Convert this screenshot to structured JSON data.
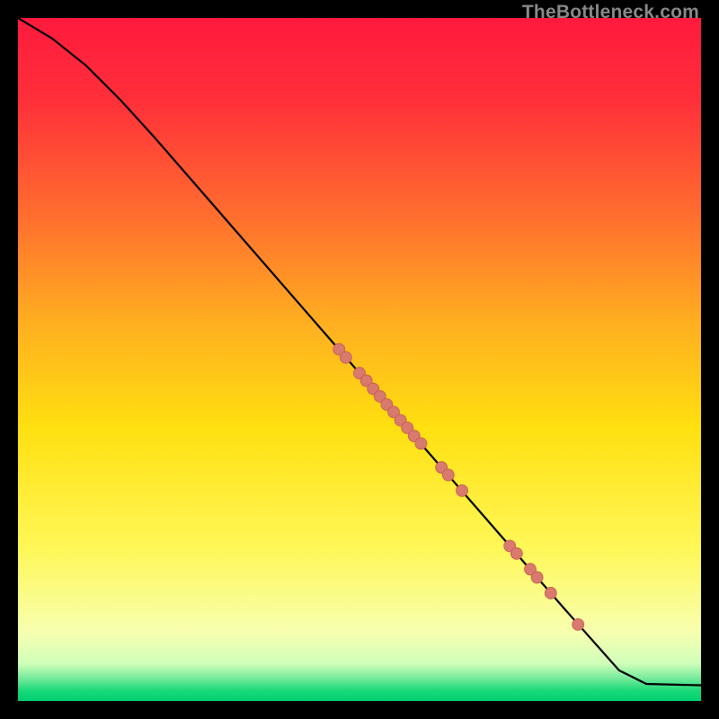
{
  "watermark": "TheBottleneck.com",
  "colors": {
    "background": "#000000",
    "gradient_stops": [
      {
        "offset": 0.0,
        "color": "#ff1a3d"
      },
      {
        "offset": 0.12,
        "color": "#ff2f3a"
      },
      {
        "offset": 0.28,
        "color": "#ff6a2f"
      },
      {
        "offset": 0.45,
        "color": "#ffb020"
      },
      {
        "offset": 0.6,
        "color": "#ffe010"
      },
      {
        "offset": 0.78,
        "color": "#fff85a"
      },
      {
        "offset": 0.9,
        "color": "#f7ffb0"
      },
      {
        "offset": 0.945,
        "color": "#d0ffba"
      },
      {
        "offset": 0.965,
        "color": "#7eec9e"
      },
      {
        "offset": 0.985,
        "color": "#18d978"
      },
      {
        "offset": 1.0,
        "color": "#00d072"
      }
    ],
    "curve": "#000000",
    "point_fill": "#d87a6e",
    "point_stroke": "#c65a4e"
  },
  "chart_data": {
    "type": "line",
    "title": "",
    "xlabel": "",
    "ylabel": "",
    "xlim": [
      0,
      100
    ],
    "ylim": [
      0,
      100
    ],
    "curve": [
      {
        "x": 0,
        "y": 100
      },
      {
        "x": 5,
        "y": 97
      },
      {
        "x": 10,
        "y": 93
      },
      {
        "x": 15,
        "y": 88
      },
      {
        "x": 20,
        "y": 82.5
      },
      {
        "x": 30,
        "y": 71
      },
      {
        "x": 40,
        "y": 59.5
      },
      {
        "x": 50,
        "y": 48
      },
      {
        "x": 60,
        "y": 36.5
      },
      {
        "x": 70,
        "y": 25
      },
      {
        "x": 80,
        "y": 13.5
      },
      {
        "x": 88,
        "y": 4.5
      },
      {
        "x": 92,
        "y": 2.5
      },
      {
        "x": 100,
        "y": 2.3
      }
    ],
    "points": [
      {
        "x": 47,
        "y": 51.5
      },
      {
        "x": 48,
        "y": 50.3
      },
      {
        "x": 50,
        "y": 48.0
      },
      {
        "x": 51,
        "y": 46.9
      },
      {
        "x": 52,
        "y": 45.7
      },
      {
        "x": 53,
        "y": 44.6
      },
      {
        "x": 54,
        "y": 43.4
      },
      {
        "x": 55,
        "y": 42.3
      },
      {
        "x": 56,
        "y": 41.1
      },
      {
        "x": 57,
        "y": 40.0
      },
      {
        "x": 58,
        "y": 38.8
      },
      {
        "x": 59,
        "y": 37.7
      },
      {
        "x": 62,
        "y": 34.2
      },
      {
        "x": 63,
        "y": 33.1
      },
      {
        "x": 65,
        "y": 30.8
      },
      {
        "x": 72,
        "y": 22.7
      },
      {
        "x": 73,
        "y": 21.6
      },
      {
        "x": 75,
        "y": 19.3
      },
      {
        "x": 76,
        "y": 18.1
      },
      {
        "x": 78,
        "y": 15.8
      },
      {
        "x": 82,
        "y": 11.2
      }
    ]
  }
}
